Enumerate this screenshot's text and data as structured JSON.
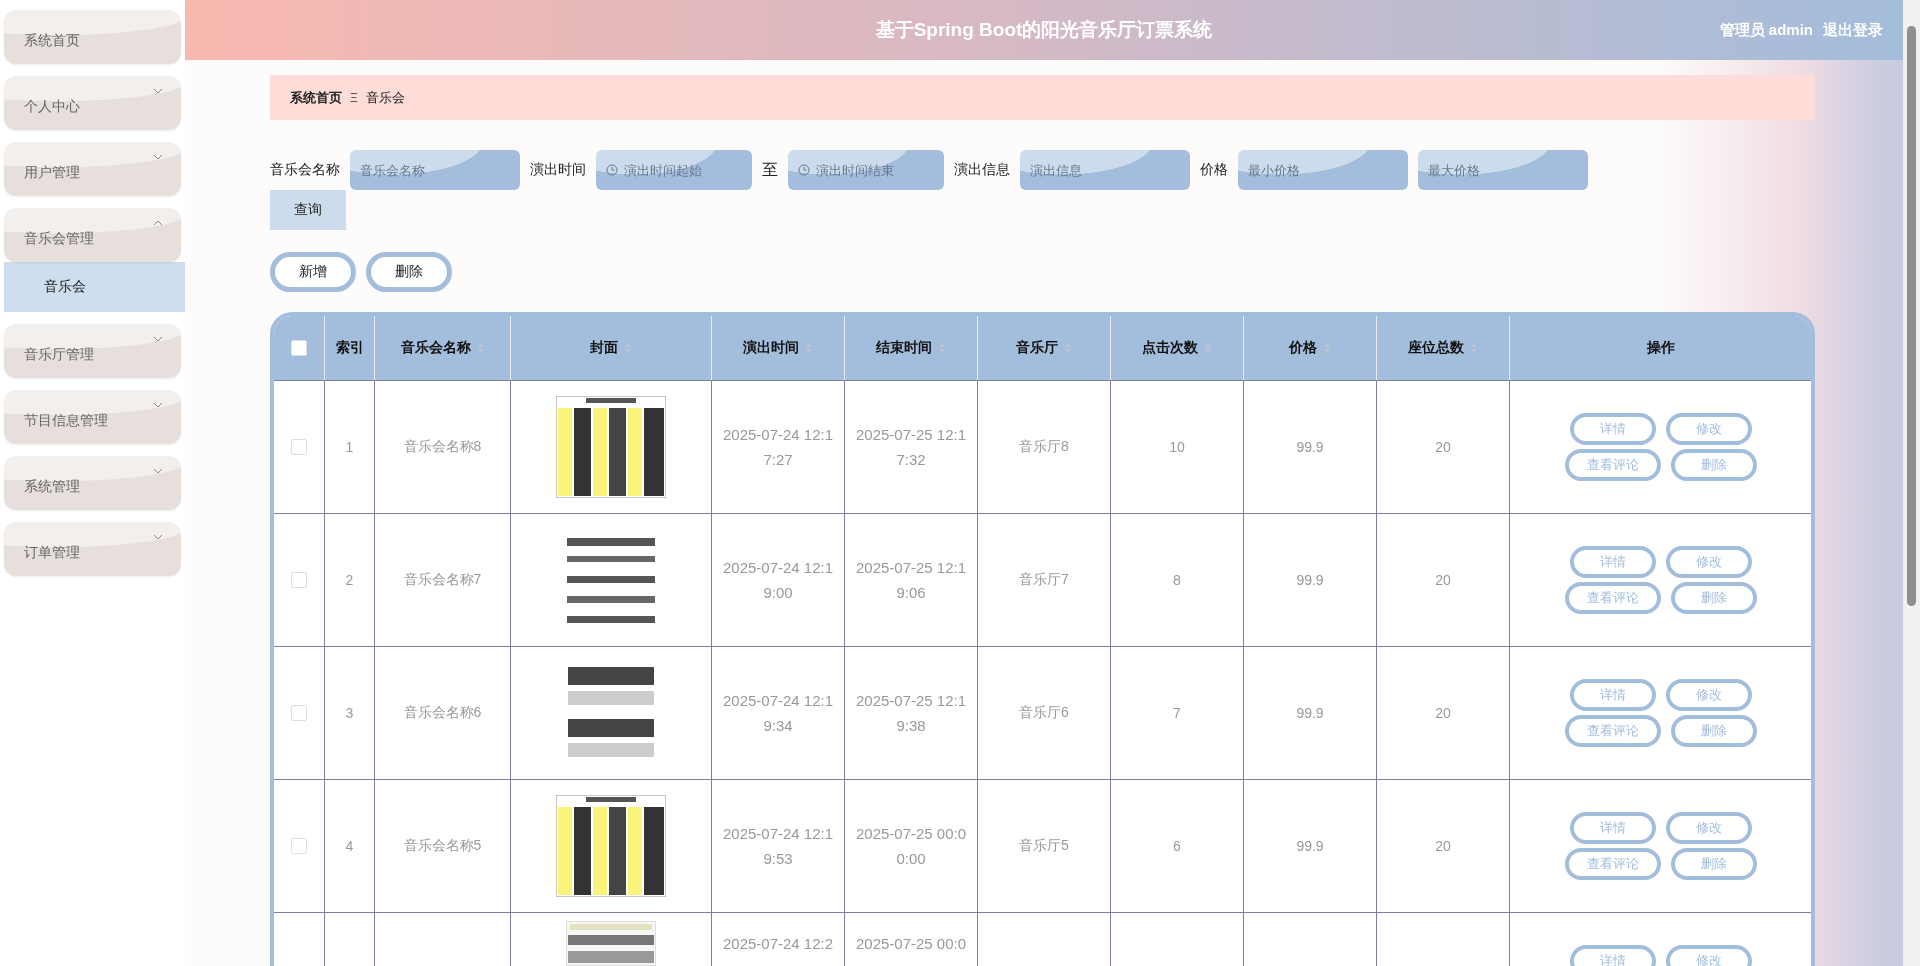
{
  "header": {
    "title": "基于Spring Boot的阳光音乐厅订票系统",
    "user": "管理员 admin",
    "logout": "退出登录"
  },
  "sidebar": {
    "items": [
      {
        "label": "系统首页",
        "kind": "link"
      },
      {
        "label": "个人中心",
        "kind": "menu",
        "expanded": false
      },
      {
        "label": "用户管理",
        "kind": "menu",
        "expanded": false
      },
      {
        "label": "音乐会管理",
        "kind": "menu",
        "expanded": true,
        "children": [
          {
            "label": "音乐会",
            "selected": true
          }
        ]
      },
      {
        "label": "音乐厅管理",
        "kind": "menu",
        "expanded": false
      },
      {
        "label": "节目信息管理",
        "kind": "menu",
        "expanded": false
      },
      {
        "label": "系统管理",
        "kind": "menu",
        "expanded": false
      },
      {
        "label": "订单管理",
        "kind": "menu",
        "expanded": false
      }
    ]
  },
  "breadcrumb": {
    "items": [
      "系统首页",
      "音乐会"
    ],
    "separator": "Ξ"
  },
  "search": {
    "fields": [
      {
        "label": "音乐会名称",
        "inputs": [
          {
            "kind": "text",
            "placeholder": "音乐会名称"
          }
        ]
      },
      {
        "label": "演出时间",
        "joiner": "至",
        "inputs": [
          {
            "kind": "date",
            "placeholder": "演出时间起始"
          },
          {
            "kind": "date",
            "placeholder": "演出时间结束"
          }
        ]
      },
      {
        "label": "演出信息",
        "inputs": [
          {
            "kind": "text",
            "placeholder": "演出信息"
          }
        ]
      },
      {
        "label": "价格",
        "inputs": [
          {
            "kind": "text",
            "placeholder": "最小价格"
          },
          {
            "kind": "text",
            "placeholder": "最大价格"
          }
        ]
      }
    ],
    "submit": "查询"
  },
  "actions": [
    "新增",
    "删除"
  ],
  "table": {
    "select_all": false,
    "columns": [
      {
        "label": "索引",
        "sortable": false
      },
      {
        "label": "音乐会名称",
        "sortable": true
      },
      {
        "label": "封面",
        "sortable": true
      },
      {
        "label": "演出时间",
        "sortable": true
      },
      {
        "label": "结束时间",
        "sortable": true
      },
      {
        "label": "音乐厅",
        "sortable": true
      },
      {
        "label": "点击次数",
        "sortable": true
      },
      {
        "label": "价格",
        "sortable": true
      },
      {
        "label": "座位总数",
        "sortable": true
      },
      {
        "label": "操作",
        "sortable": false
      }
    ],
    "rows": [
      {
        "checked": false,
        "index": "1",
        "name": "音乐会名称8",
        "start": "2025-07-24 12:17:27",
        "end": "2025-07-25 12:17:32",
        "hall": "音乐厅8",
        "clicks": "10",
        "price": "99.9",
        "seats": "20",
        "actions": [
          "详情",
          "修改",
          "查看评论",
          "删除"
        ]
      },
      {
        "checked": false,
        "index": "2",
        "name": "音乐会名称7",
        "start": "2025-07-24 12:19:00",
        "end": "2025-07-25 12:19:06",
        "hall": "音乐厅7",
        "clicks": "8",
        "price": "99.9",
        "seats": "20",
        "actions": [
          "详情",
          "修改",
          "查看评论",
          "删除"
        ]
      },
      {
        "checked": false,
        "index": "3",
        "name": "音乐会名称6",
        "start": "2025-07-24 12:19:34",
        "end": "2025-07-25 12:19:38",
        "hall": "音乐厅6",
        "clicks": "7",
        "price": "99.9",
        "seats": "20",
        "actions": [
          "详情",
          "修改",
          "查看评论",
          "删除"
        ]
      },
      {
        "checked": false,
        "index": "4",
        "name": "音乐会名称5",
        "start": "2025-07-24 12:19:53",
        "end": "2025-07-25 00:00:00",
        "hall": "音乐厅5",
        "clicks": "6",
        "price": "99.9",
        "seats": "20",
        "actions": [
          "详情",
          "修改",
          "查看评论",
          "删除"
        ]
      },
      {
        "start": "2025-07-24 12:2",
        "end": "2025-07-25 00:0",
        "actions": [
          "详情",
          "修改"
        ]
      }
    ]
  }
}
